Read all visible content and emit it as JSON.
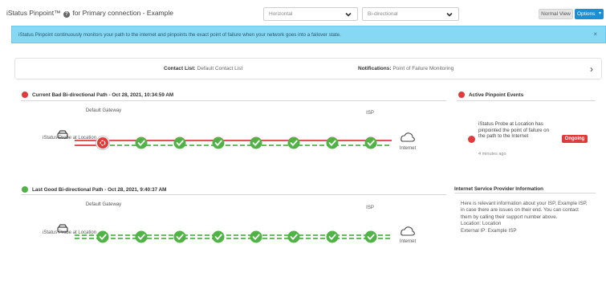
{
  "header": {
    "title": "iStatus Pinpoint™",
    "title_suffix": "for Primary connection - Example",
    "help_glyph": "?",
    "layout_select": "Horizontal",
    "direction_select": "Bi-directional",
    "normal_view_label": "Normal View",
    "options_label": "Options"
  },
  "banner": {
    "text": "iStatus Pinpoint continuously monitors your path to the internet and pinpoints the exact point of failure when your network goes into a failover state.",
    "close_glyph": "×"
  },
  "contact_bar": {
    "contact_label": "Contact List:",
    "contact_value": "Default Contact List",
    "notifications_label": "Notifications:",
    "notifications_value": "Point of Failure Monitoring"
  },
  "current_path": {
    "title": "Current Bad Bi-directional Path - Oct 28, 2021, 10:34:59 AM",
    "gateway_label": "Default Gateway",
    "isp_label": "ISP",
    "probe_label": "iStatus Probe at Location",
    "internet_label": "Internet",
    "hops": [
      "fail",
      "ok",
      "ok",
      "ok",
      "ok",
      "ok",
      "ok",
      "ok"
    ]
  },
  "good_path": {
    "title": "Last Good Bi-directional Path - Oct 28, 2021, 9:40:37 AM",
    "gateway_label": "Default Gateway",
    "isp_label": "ISP",
    "probe_label": "iStatus Probe at Location",
    "internet_label": "Internet",
    "hops": [
      "ok",
      "ok",
      "ok",
      "ok",
      "ok",
      "ok",
      "ok",
      "ok"
    ]
  },
  "events": {
    "title": "Active Pinpoint Events",
    "event_text": "iStatus Probe at Location has pinpointed the point of failure on the path to the Internet",
    "event_time": "4 minutes ago",
    "status": "Ongoing"
  },
  "isp_info": {
    "title": "Internet Service Provider Information",
    "lines": [
      "Here is relevant information about your ISP, Example ISP,",
      "in case there are issues on their end. You can contact",
      "them by calling their support number above.",
      "Location: Location",
      "External IP: Example ISP"
    ]
  },
  "colors": {
    "fail": "#e03a3a",
    "ok": "#51b347",
    "accent": "#1a8fd6",
    "banner": "#86d8f4"
  }
}
